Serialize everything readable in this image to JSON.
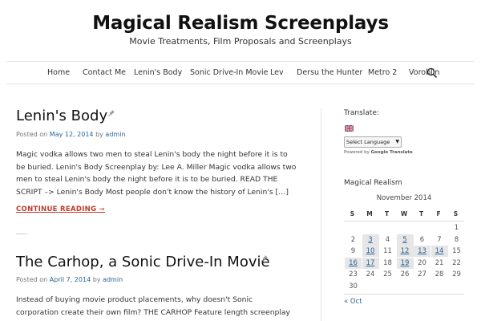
{
  "site": {
    "title": "Magical Realism Screenplays",
    "description": "Movie Treatments, Film Proposals and Screenplays"
  },
  "nav": {
    "items": [
      "Home",
      "Contact Me",
      "Lenin's Body",
      "Sonic Drive-In Movie",
      "Lev",
      "Dersu the Hunter",
      "Metro 2",
      "Voroblin"
    ],
    "search_icon": "search-icon"
  },
  "posts": [
    {
      "title": "Lenin's Body",
      "meta_prefix": "Posted on",
      "date": "May 12, 2014",
      "by": "by",
      "author": "admin",
      "excerpt": "Magic vodka allows two men to steal Lenin's body the night before it is to be buried. Lenin's Body Screenplay by: Lee A. Miller Magic vodka allows two men to steal Lenin's body the night before it is to be buried. READ THE SCRIPT –> Lenin's Body Most people don't know the history of Lenin's […]",
      "read_more": "CONTINUE READING ➞"
    },
    {
      "title": "The Carhop, a Sonic Drive-In Movie",
      "meta_prefix": "Posted on",
      "date": "April 7, 2014",
      "by": "by",
      "author": "admin",
      "excerpt": "Instead of buying movie product placements, why doesn't Sonic corporation create their own film? THE CARHOP Feature length screenplay by Lee A. Miller Actors: T.J. Lynch and Lore Peters Tamara Dalenski..."
    }
  ],
  "sidebar": {
    "translate_title": "Translate:",
    "language_select": "Select Language",
    "powered_by": "Powered by",
    "google": "Google",
    "translate_word": "Translate",
    "calendar_title": "Magical Realism",
    "calendar": {
      "caption": "November 2014",
      "headers": [
        "S",
        "M",
        "T",
        "W",
        "T",
        "F",
        "S"
      ],
      "rows": [
        [
          "",
          "",
          "",
          "",
          "",
          "",
          "1"
        ],
        [
          "2",
          "3",
          "4",
          "5",
          "6",
          "7",
          "8"
        ],
        [
          "9",
          "10",
          "11",
          "12",
          "13",
          "14",
          "15"
        ],
        [
          "16",
          "17",
          "18",
          "19",
          "20",
          "21",
          "22"
        ],
        [
          "23",
          "24",
          "25",
          "26",
          "27",
          "28",
          "29"
        ],
        [
          "30",
          "",
          "",
          "",
          "",
          "",
          ""
        ]
      ],
      "linked_days": [
        "3",
        "5",
        "10",
        "12",
        "13",
        "14",
        "16",
        "17",
        "19"
      ]
    },
    "prev_month": "« Oct"
  },
  "colors": {
    "link": "#2a6496",
    "read_more": "#c0392b",
    "calendar_linked_bg": "#e6e6e6"
  }
}
